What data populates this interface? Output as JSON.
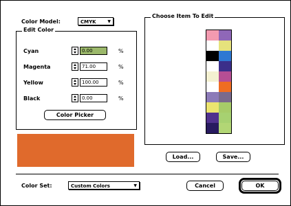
{
  "colors": {
    "accent_fill": "#e06a2c",
    "cyan_field_bg": "#9bb86a"
  },
  "color_model": {
    "label": "Color Model:",
    "value": "CMYK"
  },
  "edit_color": {
    "title": "Edit Color",
    "fields": [
      {
        "label": "Cyan",
        "value": "0.00",
        "unit": "%"
      },
      {
        "label": "Magenta",
        "value": "71.00",
        "unit": "%"
      },
      {
        "label": "Yellow",
        "value": "100.00",
        "unit": "%"
      },
      {
        "label": "Black",
        "value": "0.00",
        "unit": "%"
      }
    ],
    "picker_button": "Color Picker"
  },
  "choose_item": {
    "title": "Choose Item To Edit"
  },
  "swatches": [
    {
      "left": "#f39ab0",
      "right": "#8f67b8"
    },
    {
      "left": "#ffffff",
      "right": "#e6e27c"
    },
    {
      "left": "#000000",
      "right": "#2f78d2"
    },
    {
      "left": "#ffffff",
      "right": "#3b2f8a"
    },
    {
      "left": "#f4f1d1",
      "right": "#b64e94"
    },
    {
      "left": "#ffffff",
      "right": "#ef6d22"
    },
    {
      "left": "#8c7ab8",
      "right": "#7a6a8c"
    },
    {
      "left": "#ece46f",
      "right": "#a7cc68"
    },
    {
      "left": "#50318e",
      "right": "#a7d171"
    },
    {
      "left": "#281a5f",
      "right": "#b2d675"
    }
  ],
  "buttons": {
    "load": "Load...",
    "save": "Save...",
    "cancel": "Cancel",
    "ok": "OK"
  },
  "color_set": {
    "label": "Color Set:",
    "value": "Custom Colors"
  }
}
